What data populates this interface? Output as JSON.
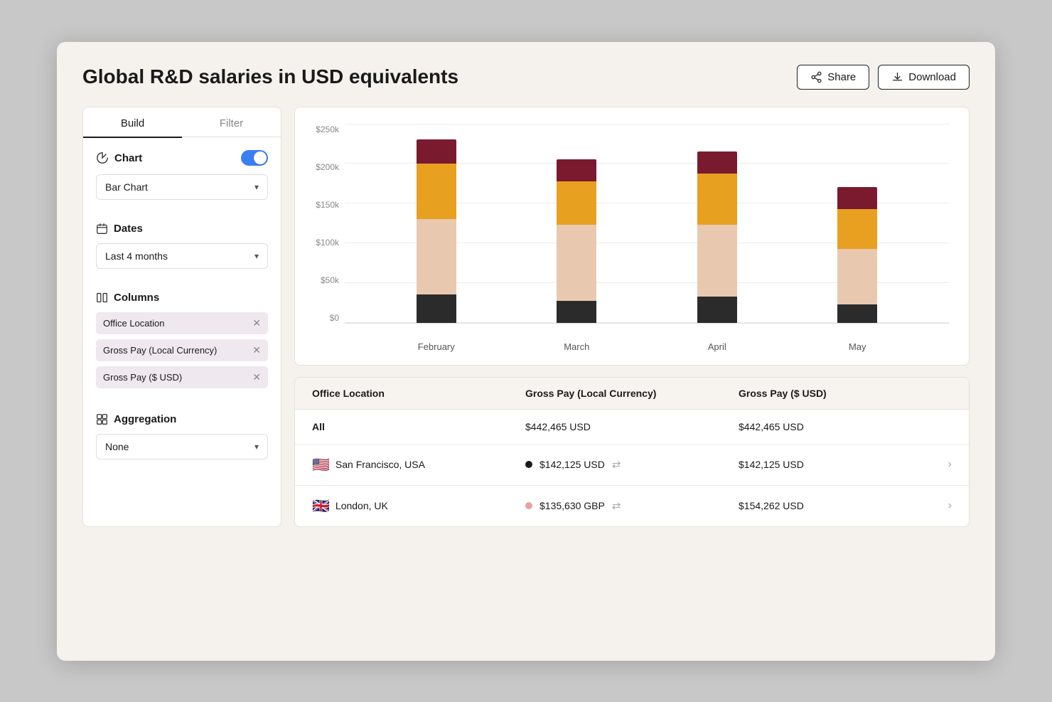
{
  "header": {
    "title": "Global R&D salaries in USD equivalents",
    "share_label": "Share",
    "download_label": "Download"
  },
  "sidebar": {
    "tab_build": "Build",
    "tab_filter": "Filter",
    "chart_label": "Chart",
    "chart_type": "Bar Chart",
    "dates_label": "Dates",
    "dates_value": "Last 4 months",
    "columns_label": "Columns",
    "columns": [
      {
        "label": "Office Location"
      },
      {
        "label": "Gross Pay (Local Currency)"
      },
      {
        "label": "Gross Pay ($ USD)"
      }
    ],
    "aggregation_label": "Aggregation",
    "aggregation_value": "None"
  },
  "chart": {
    "y_labels": [
      "$0",
      "$50k",
      "$100k",
      "$150k",
      "$200k",
      "$250k"
    ],
    "bars": [
      {
        "month": "February",
        "segments": [
          {
            "color": "#7a1a2e",
            "height_pct": 12
          },
          {
            "color": "#e8a020",
            "height_pct": 28
          },
          {
            "color": "#e8c9b0",
            "height_pct": 38
          },
          {
            "color": "#2b2b2b",
            "height_pct": 14
          }
        ],
        "total_pct": 92
      },
      {
        "month": "March",
        "segments": [
          {
            "color": "#7a1a2e",
            "height_pct": 11
          },
          {
            "color": "#e8a020",
            "height_pct": 22
          },
          {
            "color": "#e8c9b0",
            "height_pct": 38
          },
          {
            "color": "#2b2b2b",
            "height_pct": 11
          }
        ],
        "total_pct": 82
      },
      {
        "month": "April",
        "segments": [
          {
            "color": "#7a1a2e",
            "height_pct": 11
          },
          {
            "color": "#e8a020",
            "height_pct": 26
          },
          {
            "color": "#e8c9b0",
            "height_pct": 36
          },
          {
            "color": "#2b2b2b",
            "height_pct": 13
          }
        ],
        "total_pct": 86
      },
      {
        "month": "May",
        "segments": [
          {
            "color": "#7a1a2e",
            "height_pct": 11
          },
          {
            "color": "#e8a020",
            "height_pct": 20
          },
          {
            "color": "#e8c9b0",
            "height_pct": 28
          },
          {
            "color": "#2b2b2b",
            "height_pct": 9
          }
        ],
        "total_pct": 68
      }
    ]
  },
  "table": {
    "columns": [
      "Office Location",
      "Gross Pay (Local Currency)",
      "Gross Pay ($ USD)"
    ],
    "rows": [
      {
        "location": "All",
        "flag": "",
        "gross_local": "$442,465 USD",
        "gross_usd": "$442,465 USD",
        "show_dot": false,
        "show_exchange": false,
        "show_chevron": false,
        "dot_color": ""
      },
      {
        "location": "San Francisco, USA",
        "flag": "🇺🇸",
        "gross_local": "$142,125 USD",
        "gross_usd": "$142,125 USD",
        "show_dot": true,
        "show_exchange": true,
        "show_chevron": true,
        "dot_color": "#1a1a1a"
      },
      {
        "location": "London, UK",
        "flag": "🇬🇧",
        "gross_local": "$135,630 GBP",
        "gross_usd": "$154,262 USD",
        "show_dot": true,
        "show_exchange": true,
        "show_chevron": true,
        "dot_color": "#e8a0a0"
      }
    ]
  }
}
